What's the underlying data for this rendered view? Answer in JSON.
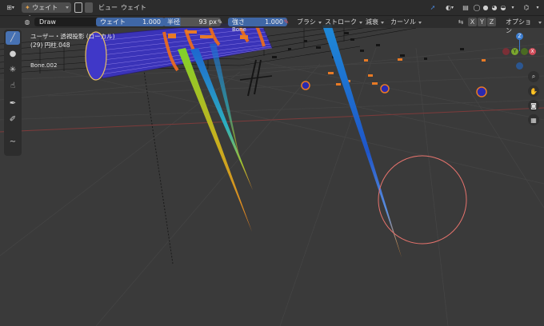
{
  "header": {
    "mode": "ウェイトペ...",
    "menus": [
      "ビュー",
      "ウェイト"
    ],
    "brush_name": "Draw",
    "weight": {
      "label": "ウェイト",
      "value": "1.000"
    },
    "radius": {
      "label": "半径",
      "value": "93 px"
    },
    "strength": {
      "label": "強さ",
      "value": "1.000"
    },
    "brush_menu": "ブラシ",
    "stroke_menu": "ストローク",
    "falloff_menu": "減衰",
    "cursor_menu": "カーソル",
    "options_menu": "オプション",
    "axes": [
      "X",
      "Y",
      "Z"
    ]
  },
  "viewport": {
    "view_name": "ユーザー・透視投影 (ローカル)",
    "object_name": "(29) 円柱.048",
    "bone_label_top": "Bone",
    "bone_label_side": "Bone.002"
  },
  "gizmo": {
    "x": "X",
    "y": "Y",
    "z": "Z"
  },
  "colors": {
    "accent": "#4772b3",
    "axis_x": "#d04b59",
    "axis_y": "#7aa52d",
    "axis_z": "#3b7ccf",
    "brush_circle": "#e7736d"
  },
  "icons": {
    "editor_type": "grid-icon",
    "mode": "weight-paint-icon",
    "tools": [
      "draw-brush-icon",
      "blur-icon",
      "average-icon",
      "smear-icon",
      "sample-weight-icon",
      "sample-group-icon",
      "gradient-icon"
    ],
    "nav": [
      "zoom-icon",
      "hand-icon",
      "camera-icon",
      "grid-view-icon"
    ]
  }
}
